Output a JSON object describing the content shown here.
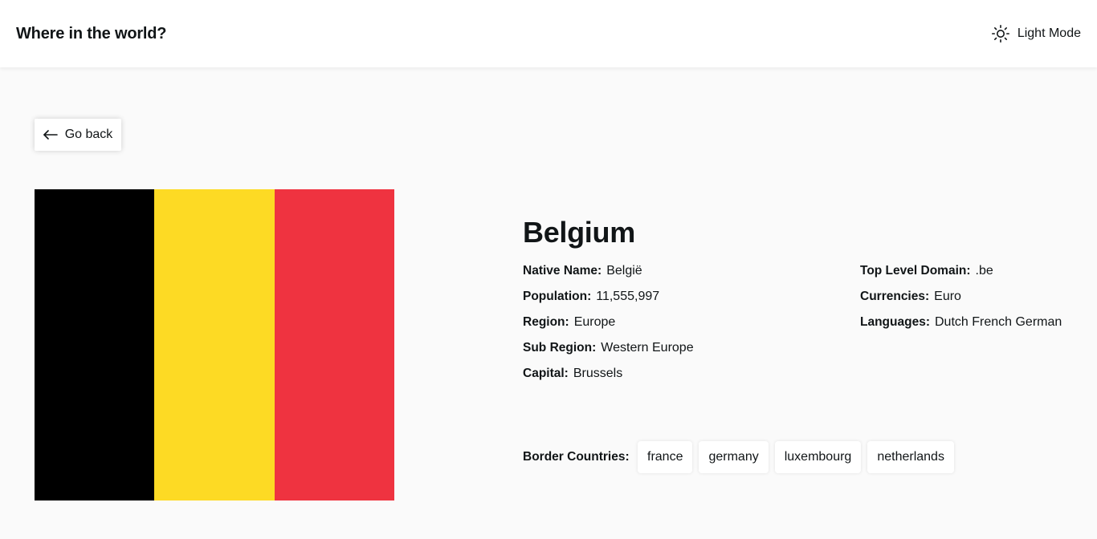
{
  "header": {
    "title": "Where in the world?",
    "mode_label": "Light Mode",
    "mode_icon": "sun-icon"
  },
  "back": {
    "label": "Go back",
    "icon": "arrow-left-icon"
  },
  "country": {
    "name": "Belgium",
    "flag_colors": [
      "#000000",
      "#FDDA24",
      "#EF3340"
    ],
    "left_column": [
      {
        "key": "Native Name:",
        "value": "België"
      },
      {
        "key": "Population:",
        "value": "11,555,997"
      },
      {
        "key": "Region:",
        "value": "Europe"
      },
      {
        "key": "Sub Region:",
        "value": "Western Europe"
      },
      {
        "key": "Capital:",
        "value": "Brussels"
      }
    ],
    "right_column": [
      {
        "key": "Top Level Domain:",
        "value": ".be"
      },
      {
        "key": "Currencies:",
        "value": "Euro"
      },
      {
        "key": "Languages:",
        "value": "Dutch French German"
      }
    ],
    "border_label": "Border Countries:",
    "borders": [
      "france",
      "germany",
      "luxembourg",
      "netherlands"
    ]
  }
}
